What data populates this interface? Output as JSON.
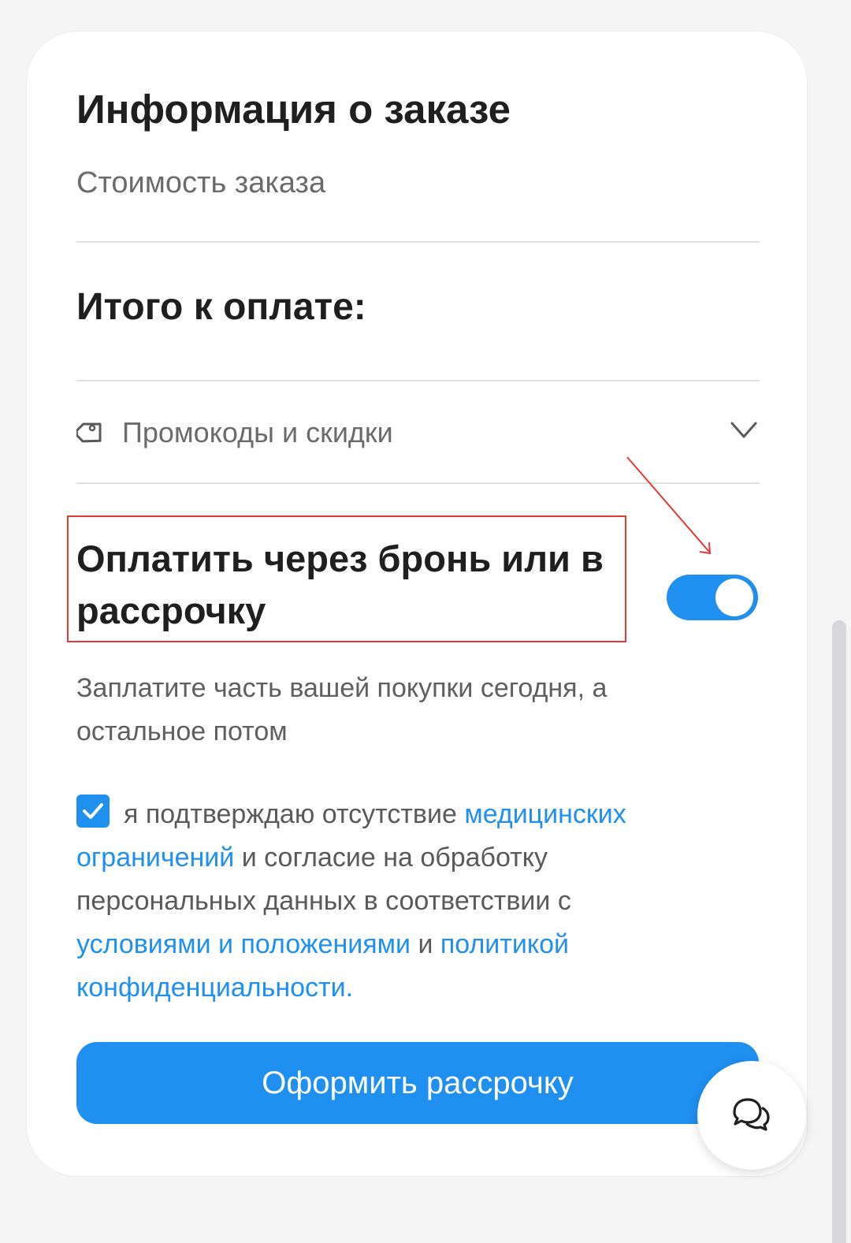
{
  "order_info": {
    "title": "Информация о заказе",
    "cost_label": "Стоимость заказа",
    "total_label": "Итого к оплате:"
  },
  "promo": {
    "label": "Промокоды и скидки",
    "icon": "tag-icon",
    "expand_icon": "chevron-down-icon"
  },
  "installment": {
    "title": "Оплатить через бронь или в рассрочку",
    "enabled": true,
    "description": "Заплатите часть вашей покупки сегодня, а остальное потом"
  },
  "consent": {
    "checked": true,
    "text_1": "я подтверждаю отсутствие ",
    "link_medical": "медицинских ограничений",
    "text_2": " и согласие на обработку персональных данных в соответствии с ",
    "link_terms": "условиями и положениями",
    "text_3": " и ",
    "link_privacy": "политикой конфиденциальности",
    "text_4": "."
  },
  "submit_button": {
    "label": "Оформить рассрочку"
  },
  "chat": {
    "icon": "chat-bubbles-icon"
  },
  "colors": {
    "accent": "#1f8ff0",
    "annotation": "#e53935",
    "background": "#f5f5f6",
    "card": "#ffffff"
  }
}
